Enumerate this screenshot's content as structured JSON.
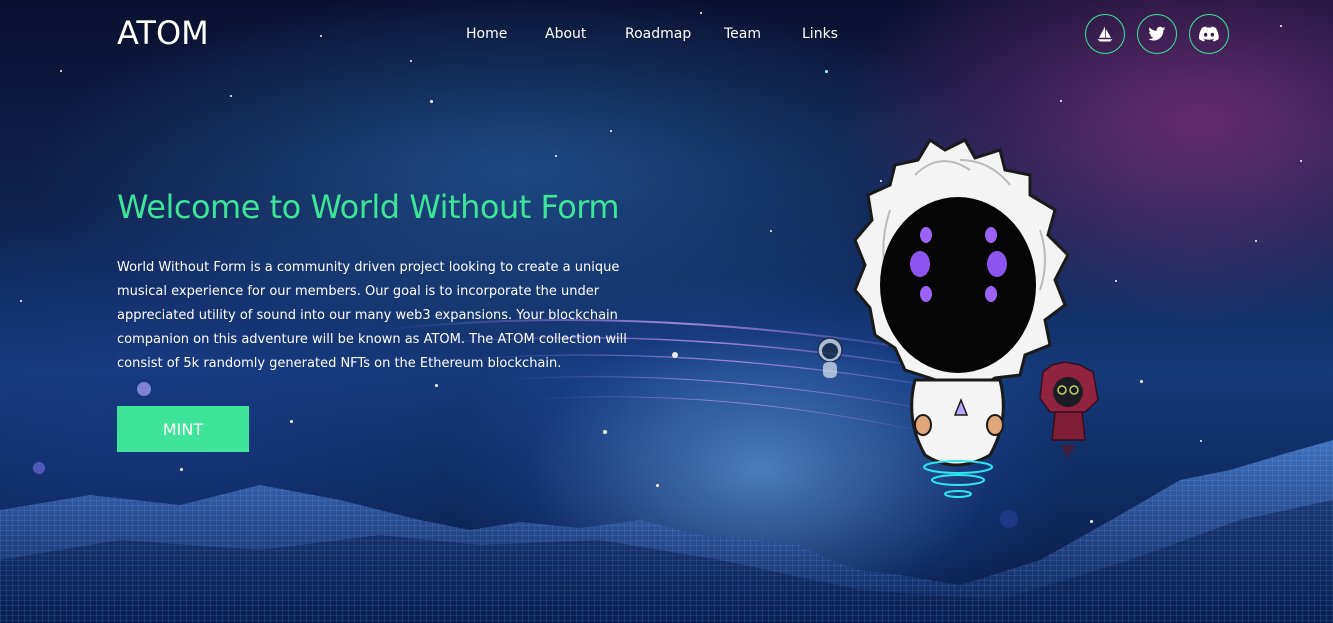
{
  "header": {
    "logo": "ATOM",
    "nav": [
      {
        "label": "Home"
      },
      {
        "label": "About"
      },
      {
        "label": "Roadmap"
      },
      {
        "label": "Team"
      },
      {
        "label": "Links"
      }
    ],
    "social": [
      {
        "icon": "sailboat-icon",
        "name": "opensea"
      },
      {
        "icon": "twitter-icon",
        "name": "twitter"
      },
      {
        "icon": "discord-icon",
        "name": "discord"
      }
    ]
  },
  "hero": {
    "title": "Welcome to World Without Form",
    "description": "World Without Form is a community driven project looking to create a unique musical experience for our members. Our goal is to incorporate the under appreciated utility of sound into our many web3 expansions. Your blockchain companion on this adventure will be known as ATOM. The ATOM collection will consist of 5k randomly generated NFTs on the Ethereum blockchain.",
    "mint_label": "MINT"
  },
  "colors": {
    "accent": "#3fe39a",
    "text": "#ffffff",
    "background": "#0b1030"
  }
}
